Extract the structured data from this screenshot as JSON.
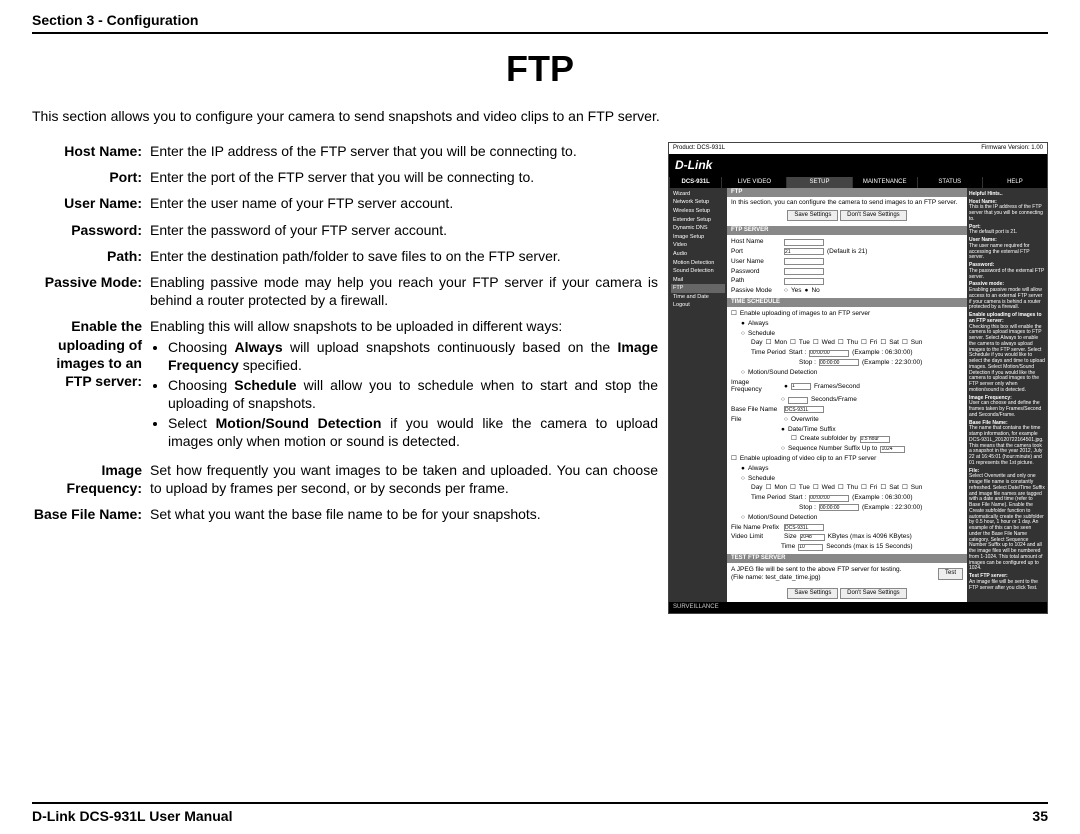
{
  "header": {
    "section": "Section 3 - Configuration"
  },
  "title": "FTP",
  "intro": "This section allows you to configure your camera to send snapshots and video clips to an FTP server.",
  "defs": {
    "host": {
      "label": "Host Name:",
      "desc": "Enter the IP address of the FTP server that you will be connecting to."
    },
    "port": {
      "label": "Port:",
      "desc": "Enter the port of the FTP server that you will be connecting to."
    },
    "user": {
      "label": "User Name:",
      "desc": "Enter the user name of your FTP server account."
    },
    "pass": {
      "label": "Password:",
      "desc": "Enter the password of your FTP server account."
    },
    "path": {
      "label": "Path:",
      "desc": "Enter the destination path/folder to save files to on the FTP server."
    },
    "passive": {
      "label": "Passive Mode:",
      "desc": "Enabling passive mode may help you reach your FTP server if your camera is behind a router protected by a firewall."
    },
    "enable": {
      "label": "Enable the uploading of images to an FTP server:",
      "desc": "Enabling this will allow snapshots to be uploaded in different ways:",
      "b1a": "Choosing ",
      "b1b": "Always",
      "b1c": " will upload snapshots continuously based on the ",
      "b1d": "Image Frequency",
      "b1e": " specified.",
      "b2a": "Choosing ",
      "b2b": "Schedule",
      "b2c": " will allow you to schedule when to start and stop the uploading of snapshots.",
      "b3a": "Select ",
      "b3b": "Motion/Sound Detection",
      "b3c": " if you would like the camera to upload images only when motion or sound is detected."
    },
    "imgfreq": {
      "label": "Image Frequency:",
      "desc": "Set how frequently you want images to be taken and uploaded. You can choose to upload by frames per second, or by seconds per frame."
    },
    "basefile": {
      "label": "Base File Name:",
      "desc": "Set what you want the base file name to be for your snapshots."
    }
  },
  "shot": {
    "product": "Product: DCS-931L",
    "fw": "Firmware Version: 1.00",
    "brand": "D-Link",
    "model": "DCS-931L",
    "tabs": [
      "LIVE VIDEO",
      "SETUP",
      "MAINTENANCE",
      "STATUS",
      "HELP"
    ],
    "side": [
      "Wizard",
      "Network Setup",
      "Wireless Setup",
      "Extender Setup",
      "Dynamic DNS",
      "Image Setup",
      "Video",
      "Audio",
      "Motion Detection",
      "Sound Detection",
      "Mail",
      "FTP",
      "Time and Date",
      "Logout"
    ],
    "ftp_title": "FTP",
    "ftp_desc": "In this section, you can configure the camera to send images to an FTP server.",
    "save": "Save Settings",
    "dont": "Don't Save Settings",
    "sec_server": "FTP SERVER",
    "lbl_host": "Host Name",
    "lbl_port": "Port",
    "val_port": "21",
    "port_hint": "(Default is 21)",
    "lbl_user": "User Name",
    "lbl_pass": "Password",
    "lbl_path": "Path",
    "lbl_passive": "Passive Mode",
    "yes": "Yes",
    "no": "No",
    "sec_sched": "TIME SCHEDULE",
    "chk_enable_img": "Enable uploading of images to an FTP server",
    "opt_always": "Always",
    "opt_sched": "Schedule",
    "lbl_day": "Day",
    "days": [
      "Mon",
      "Tue",
      "Wed",
      "Thu",
      "Fri",
      "Sat",
      "Sun"
    ],
    "lbl_tp": "Time Period",
    "tp_start": "Start :",
    "tp_start_v": "00:00:00",
    "tp_ex1": "(Example : 06:30:00)",
    "tp_stop": "Stop :",
    "tp_stop_v": "00:00:00",
    "tp_ex2": "(Example : 22:30:00)",
    "opt_motion": "Motion/Sound Detection",
    "lbl_if": "Image Frequency",
    "if_fps": "Frames/Second",
    "if_spf": "Seconds/Frame",
    "if_v": "1",
    "lbl_bfn": "Base File Name",
    "bfn_v": "DCS-931L",
    "lbl_file": "File",
    "file_ow": "Overwrite",
    "file_dts": "Date/Time Suffix",
    "file_sub": "Create subfolder by",
    "file_sub_v": "0.5 hour",
    "file_sns": "Sequence Number Suffix Up to",
    "file_sns_v": "1024",
    "chk_enable_vid": "Enable uploading of video clip to an FTP server",
    "lbl_fnp": "File Name Prefix",
    "fnp_v": "DCS-931L",
    "lbl_vl": "Video Limit",
    "vl_size": "Size",
    "vl_size_v": "2048",
    "vl_size_hint": "KBytes (max is 4096 KBytes)",
    "vl_time": "Time",
    "vl_time_v": "10",
    "vl_time_hint": "Seconds (max is 15 Seconds)",
    "sec_test": "TEST FTP SERVER",
    "test_desc": "A JPEG file will be sent to the above FTP server for testing.",
    "test_fn": "(File name: test_date_time.jpg)",
    "btn_test": "Test",
    "foot": "SURVEILLANCE",
    "hints_title": "Helpful Hints..",
    "h_host": "Host Name:",
    "h_host_d": "This is the IP address of the FTP server that you will be connecting to.",
    "h_port": "Port:",
    "h_port_d": "The default port is 21.",
    "h_user": "User Name:",
    "h_user_d": "The user name required for accessing the external FTP server.",
    "h_pass": "Password:",
    "h_pass_d": "The password of the external FTP server.",
    "h_passive": "Passive mode:",
    "h_passive_d": "Enabling passive mode will allow access to an external FTP server if your camera is behind a router protected by a firewall.",
    "h_en": "Enable uploading of images to an FTP server:",
    "h_en_d": "Checking this box will enable the camera to upload images to FTP server. Select Always to enable the camera to always upload images to the FTP server. Select Schedule if you would like to select the days and time to upload images. Select Motion/Sound Detection if you would like the camera to upload images to the FTP server only when motion/sound is detected.",
    "h_if": "Image Frequency:",
    "h_if_d": "User can choose and define the frames taken by Frames/Second and Seconds/Frame.",
    "h_bfn": "Base File Name:",
    "h_bfn_d": "The name that contains the time stamp information, for example DCS-931L_20120722164501.jpg. This means that the camera took a snapshot in the year 2012, July 22 at 16:45:01 (hour:minute) and 01 represents the 1st picture.",
    "h_file": "File:",
    "h_file_d": "Select Overwrite and only one image file name is constantly refreshed. Select Date/Time Suffix and image file names are tagged with a date and time (refer to Base File Name). Enable the Create subfolder function to automatically create the subfolder by 0.5 hour, 1 hour or 1 day. An example of this can be seen under the Base File Name category. Select Sequence Number Suffix up to 1024 and all the image files will be numbered from 1-1024. This total amount of images can be configured up to 1024.",
    "h_test": "Test FTP server:",
    "h_test_d": "An image file will be sent to the FTP server after you click Test."
  },
  "footer": {
    "manual": "D-Link DCS-931L User Manual",
    "page": "35"
  }
}
